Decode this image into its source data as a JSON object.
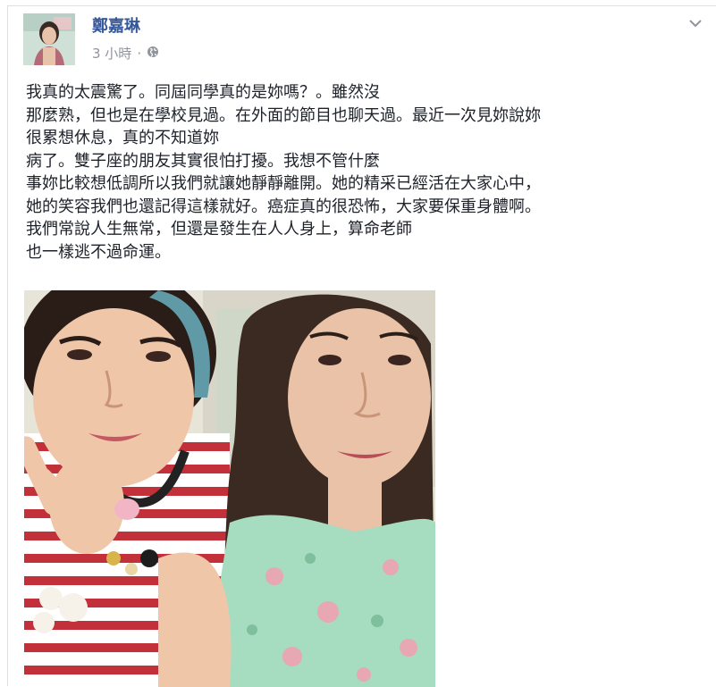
{
  "post": {
    "author": "鄭嘉琳",
    "time": "3 小時",
    "separator": "·",
    "privacy_icon": "globe-icon",
    "menu_icon": "chevron-down-icon",
    "text_lines": [
      "我真的太震驚了。同屆同學真的是妳嗎？。雖然沒",
      "那麼熟，但也是在學校見過。在外面的節目也聊天過。最近一次見妳說妳",
      "很累想休息，真的不知道妳",
      "病了。雙子座的朋友其實很怕打擾。我想不管什麼",
      "事妳比較想低調所以我們就讓她靜靜離開。她的精采已經活在大家心中，",
      "她的笑容我們也還記得這樣就好。癌症真的很恐怖，大家要保重身體啊。",
      "我們常說人生無常，但還是發生在人人身上，算命老師",
      "也一樣逃不過命運。"
    ]
  },
  "colors": {
    "author_link": "#365899",
    "meta": "#90949c",
    "text": "#1d2129",
    "border": "#dddfe2"
  }
}
